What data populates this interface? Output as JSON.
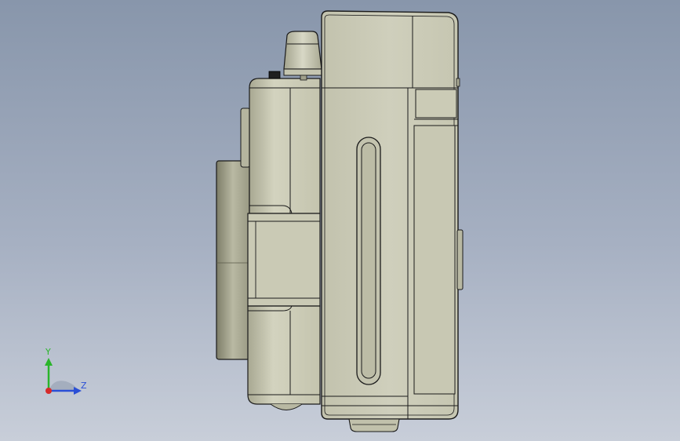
{
  "viewport": {
    "background_top": "#8896ab",
    "background_bottom": "#c8ced9"
  },
  "model": {
    "body_color": "#c9c9b4",
    "edge_color": "#1a1a1a",
    "shade_color": "#8c8c76"
  },
  "triad": {
    "y_label": "Y",
    "z_label": "Z",
    "y_color": "#2ab52a",
    "z_color": "#2a4fd6",
    "x_color": "#d62a2a"
  }
}
